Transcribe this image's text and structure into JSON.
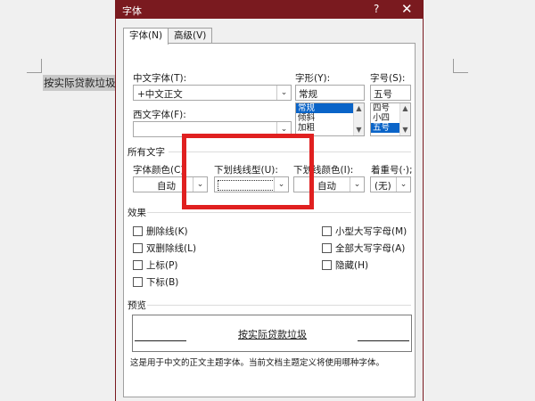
{
  "document": {
    "selected_text": "按实际贷款垃圾"
  },
  "dialog": {
    "title": "字体",
    "help_glyph": "?",
    "close_glyph": "✕",
    "tabs": [
      {
        "label": "字体(N)"
      },
      {
        "label": "高级(V)"
      }
    ]
  },
  "font_tab": {
    "chinese_font": {
      "label": "中文字体(T):",
      "value": "+中文正文"
    },
    "western_font": {
      "label": "西文字体(F):",
      "value": ""
    },
    "style": {
      "label": "字形(Y):",
      "value": "常规",
      "options": [
        "常规",
        "倾斜",
        "加粗"
      ],
      "selected": "常规"
    },
    "size": {
      "label": "字号(S):",
      "value": "五号",
      "options": [
        "四号",
        "小四",
        "五号"
      ],
      "selected": "五号"
    },
    "all_text_heading": "所有文字",
    "font_color": {
      "label": "字体颜色(C):",
      "value": "自动"
    },
    "underline_style": {
      "label": "下划线线型(U):",
      "value": ""
    },
    "underline_color": {
      "label": "下划线颜色(I):",
      "value": "自动"
    },
    "emphasis": {
      "label": "着重号(·);",
      "value": "(无)"
    },
    "effects_heading": "效果",
    "effects_left": [
      "删除线(K)",
      "双删除线(L)",
      "上标(P)",
      "下标(B)"
    ],
    "effects_right": [
      "小型大写字母(M)",
      "全部大写字母(A)",
      "隐藏(H)"
    ],
    "preview_heading": "预览",
    "preview_text": "按实际贷款垃圾",
    "description": "这是用于中文的正文主题字体。当前文档主题定义将使用哪种字体。"
  },
  "colors": {
    "titlebar": "#7a1a1f",
    "highlight": "#e02020",
    "selection": "#0a64c8"
  }
}
